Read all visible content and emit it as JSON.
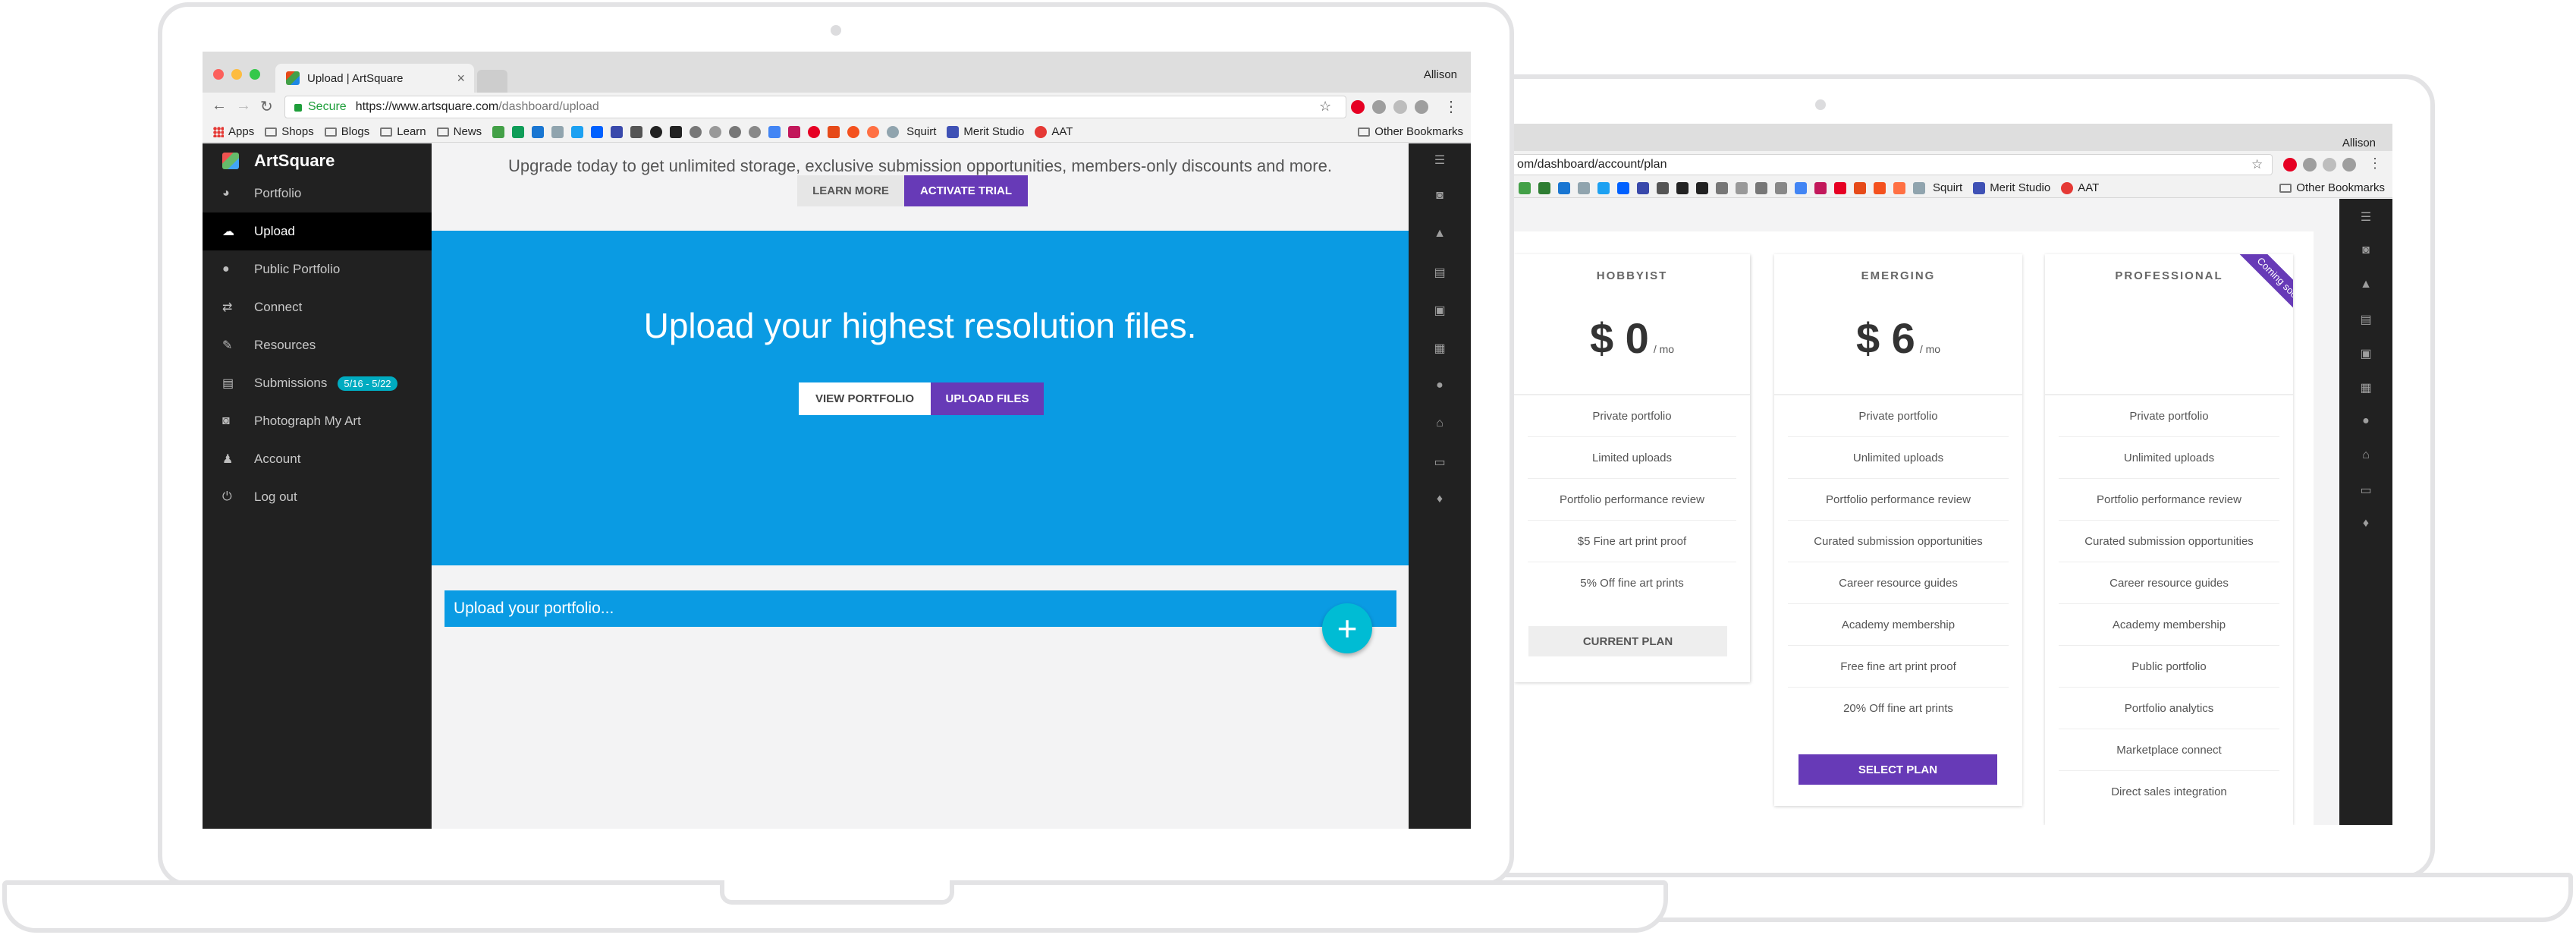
{
  "colors": {
    "hero_blue": "#0a9be3",
    "purple": "#673ab7",
    "teal_fab": "#00bcd4",
    "sidebar_dark": "#212121"
  },
  "laptop1": {
    "tab_title": "Upload | ArtSquare",
    "user_name": "Allison",
    "url_secure": "Secure",
    "url_host": "https://www.artsquare.com",
    "url_path": "/dashboard/upload",
    "bookmarks": [
      "Apps",
      "Shops",
      "Blogs",
      "Learn",
      "News"
    ],
    "bookmarks_right": [
      "Squirt",
      "Merit Studio",
      "AAT"
    ],
    "other_bookmarks": "Other Bookmarks",
    "brand": "ArtSquare",
    "sidebar": [
      {
        "label": "Portfolio",
        "icon": "palette-icon"
      },
      {
        "label": "Upload",
        "icon": "cloud-upload-icon",
        "active": true
      },
      {
        "label": "Public Portfolio",
        "icon": "account-circle-icon"
      },
      {
        "label": "Connect",
        "icon": "swap-icon"
      },
      {
        "label": "Resources",
        "icon": "wrench-icon"
      },
      {
        "label": "Submissions",
        "icon": "collections-icon",
        "badge": "5/16 - 5/22"
      },
      {
        "label": "Photograph My Art",
        "icon": "camera-icon"
      },
      {
        "label": "Account",
        "icon": "person-icon"
      },
      {
        "label": "Log out",
        "icon": "power-icon"
      }
    ],
    "upgrade_text": "Upgrade today to get unlimited storage, exclusive submission opportunities, members-only discounts and more.",
    "learn_more": "LEARN MORE",
    "activate_trial": "ACTIVATE TRIAL",
    "hero_title": "Upload your highest resolution files.",
    "view_portfolio": "VIEW PORTFOLIO",
    "upload_files": "UPLOAD FILES",
    "upload_bar": "Upload your portfolio...",
    "fab": "+"
  },
  "laptop2": {
    "user_name": "Allison",
    "url_path": "om/dashboard/account/plan",
    "bookmarks_right": [
      "Squirt",
      "Merit Studio",
      "AAT"
    ],
    "other_bookmarks": "Other Bookmarks",
    "plans": [
      {
        "name": "HOBBYIST",
        "price": "$ 0",
        "per": "/ mo",
        "features": [
          "Private portfolio",
          "Limited uploads",
          "Portfolio performance review",
          "$5 Fine art print proof",
          "5% Off fine art prints"
        ],
        "button": "CURRENT PLAN"
      },
      {
        "name": "EMERGING",
        "price": "$ 6",
        "per": "/ mo",
        "features": [
          "Private portfolio",
          "Unlimited uploads",
          "Portfolio performance review",
          "Curated submission opportunities",
          "Career resource guides",
          "Academy membership",
          "Free fine art print proof",
          "20% Off fine art prints"
        ],
        "button": "SELECT PLAN"
      },
      {
        "name": "PROFESSIONAL",
        "ribbon": "Coming soon!",
        "features": [
          "Private portfolio",
          "Unlimited uploads",
          "Portfolio performance review",
          "Curated submission opportunities",
          "Career resource guides",
          "Academy membership",
          "Public portfolio",
          "Portfolio analytics",
          "Marketplace connect",
          "Direct sales integration"
        ]
      }
    ]
  }
}
